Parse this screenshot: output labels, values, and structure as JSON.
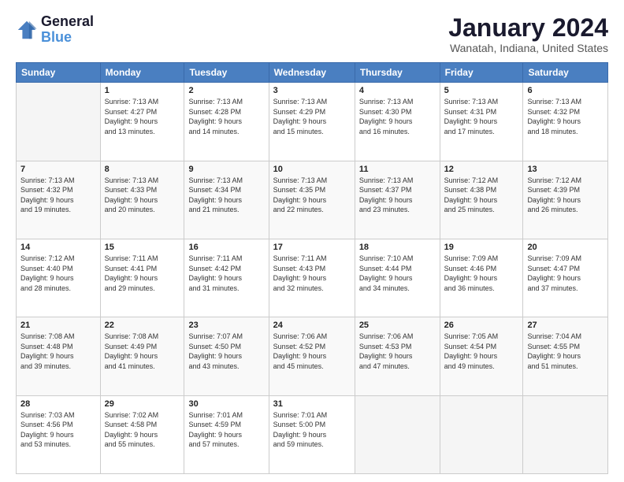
{
  "logo": {
    "line1": "General",
    "line2": "Blue"
  },
  "header": {
    "title": "January 2024",
    "subtitle": "Wanatah, Indiana, United States"
  },
  "weekdays": [
    "Sunday",
    "Monday",
    "Tuesday",
    "Wednesday",
    "Thursday",
    "Friday",
    "Saturday"
  ],
  "weeks": [
    [
      {
        "day": "",
        "content": ""
      },
      {
        "day": "1",
        "content": "Sunrise: 7:13 AM\nSunset: 4:27 PM\nDaylight: 9 hours\nand 13 minutes."
      },
      {
        "day": "2",
        "content": "Sunrise: 7:13 AM\nSunset: 4:28 PM\nDaylight: 9 hours\nand 14 minutes."
      },
      {
        "day": "3",
        "content": "Sunrise: 7:13 AM\nSunset: 4:29 PM\nDaylight: 9 hours\nand 15 minutes."
      },
      {
        "day": "4",
        "content": "Sunrise: 7:13 AM\nSunset: 4:30 PM\nDaylight: 9 hours\nand 16 minutes."
      },
      {
        "day": "5",
        "content": "Sunrise: 7:13 AM\nSunset: 4:31 PM\nDaylight: 9 hours\nand 17 minutes."
      },
      {
        "day": "6",
        "content": "Sunrise: 7:13 AM\nSunset: 4:32 PM\nDaylight: 9 hours\nand 18 minutes."
      }
    ],
    [
      {
        "day": "7",
        "content": "Sunrise: 7:13 AM\nSunset: 4:32 PM\nDaylight: 9 hours\nand 19 minutes."
      },
      {
        "day": "8",
        "content": "Sunrise: 7:13 AM\nSunset: 4:33 PM\nDaylight: 9 hours\nand 20 minutes."
      },
      {
        "day": "9",
        "content": "Sunrise: 7:13 AM\nSunset: 4:34 PM\nDaylight: 9 hours\nand 21 minutes."
      },
      {
        "day": "10",
        "content": "Sunrise: 7:13 AM\nSunset: 4:35 PM\nDaylight: 9 hours\nand 22 minutes."
      },
      {
        "day": "11",
        "content": "Sunrise: 7:13 AM\nSunset: 4:37 PM\nDaylight: 9 hours\nand 23 minutes."
      },
      {
        "day": "12",
        "content": "Sunrise: 7:12 AM\nSunset: 4:38 PM\nDaylight: 9 hours\nand 25 minutes."
      },
      {
        "day": "13",
        "content": "Sunrise: 7:12 AM\nSunset: 4:39 PM\nDaylight: 9 hours\nand 26 minutes."
      }
    ],
    [
      {
        "day": "14",
        "content": "Sunrise: 7:12 AM\nSunset: 4:40 PM\nDaylight: 9 hours\nand 28 minutes."
      },
      {
        "day": "15",
        "content": "Sunrise: 7:11 AM\nSunset: 4:41 PM\nDaylight: 9 hours\nand 29 minutes."
      },
      {
        "day": "16",
        "content": "Sunrise: 7:11 AM\nSunset: 4:42 PM\nDaylight: 9 hours\nand 31 minutes."
      },
      {
        "day": "17",
        "content": "Sunrise: 7:11 AM\nSunset: 4:43 PM\nDaylight: 9 hours\nand 32 minutes."
      },
      {
        "day": "18",
        "content": "Sunrise: 7:10 AM\nSunset: 4:44 PM\nDaylight: 9 hours\nand 34 minutes."
      },
      {
        "day": "19",
        "content": "Sunrise: 7:09 AM\nSunset: 4:46 PM\nDaylight: 9 hours\nand 36 minutes."
      },
      {
        "day": "20",
        "content": "Sunrise: 7:09 AM\nSunset: 4:47 PM\nDaylight: 9 hours\nand 37 minutes."
      }
    ],
    [
      {
        "day": "21",
        "content": "Sunrise: 7:08 AM\nSunset: 4:48 PM\nDaylight: 9 hours\nand 39 minutes."
      },
      {
        "day": "22",
        "content": "Sunrise: 7:08 AM\nSunset: 4:49 PM\nDaylight: 9 hours\nand 41 minutes."
      },
      {
        "day": "23",
        "content": "Sunrise: 7:07 AM\nSunset: 4:50 PM\nDaylight: 9 hours\nand 43 minutes."
      },
      {
        "day": "24",
        "content": "Sunrise: 7:06 AM\nSunset: 4:52 PM\nDaylight: 9 hours\nand 45 minutes."
      },
      {
        "day": "25",
        "content": "Sunrise: 7:06 AM\nSunset: 4:53 PM\nDaylight: 9 hours\nand 47 minutes."
      },
      {
        "day": "26",
        "content": "Sunrise: 7:05 AM\nSunset: 4:54 PM\nDaylight: 9 hours\nand 49 minutes."
      },
      {
        "day": "27",
        "content": "Sunrise: 7:04 AM\nSunset: 4:55 PM\nDaylight: 9 hours\nand 51 minutes."
      }
    ],
    [
      {
        "day": "28",
        "content": "Sunrise: 7:03 AM\nSunset: 4:56 PM\nDaylight: 9 hours\nand 53 minutes."
      },
      {
        "day": "29",
        "content": "Sunrise: 7:02 AM\nSunset: 4:58 PM\nDaylight: 9 hours\nand 55 minutes."
      },
      {
        "day": "30",
        "content": "Sunrise: 7:01 AM\nSunset: 4:59 PM\nDaylight: 9 hours\nand 57 minutes."
      },
      {
        "day": "31",
        "content": "Sunrise: 7:01 AM\nSunset: 5:00 PM\nDaylight: 9 hours\nand 59 minutes."
      },
      {
        "day": "",
        "content": ""
      },
      {
        "day": "",
        "content": ""
      },
      {
        "day": "",
        "content": ""
      }
    ]
  ]
}
